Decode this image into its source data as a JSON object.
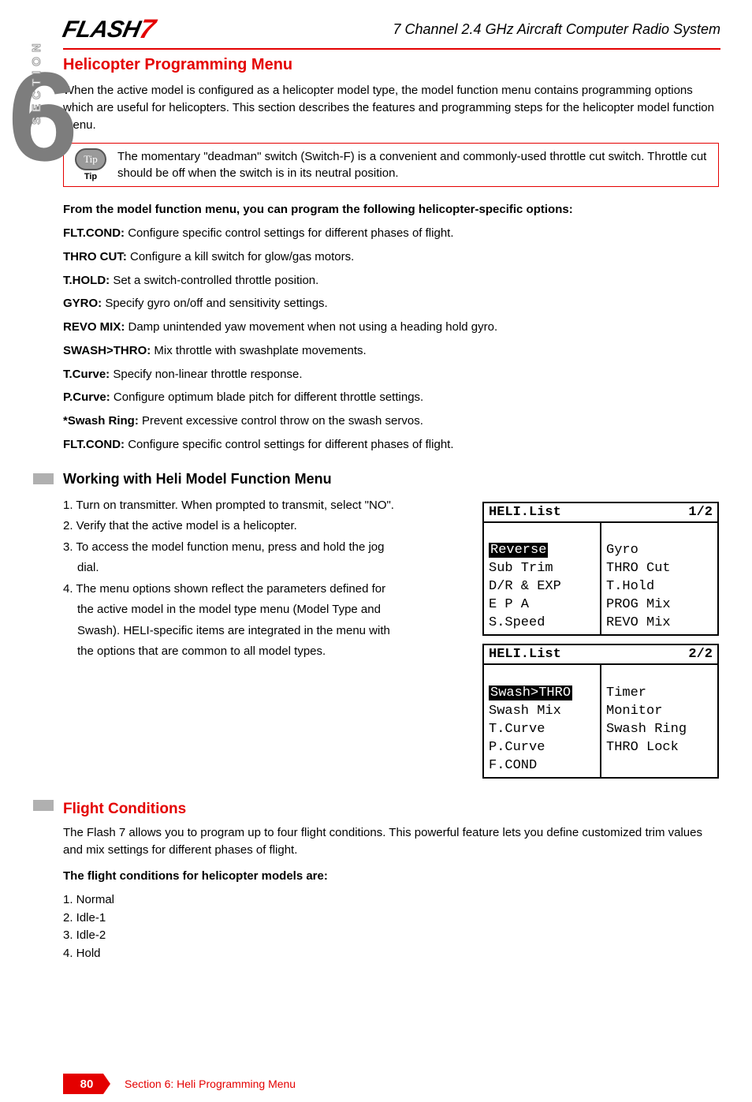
{
  "header": {
    "logo_main": "FLASH",
    "logo_accent": "7",
    "subtitle": "7 Channel 2.4 GHz Aircraft Computer Radio System"
  },
  "side_tab": {
    "number": "6",
    "label": "SECTION"
  },
  "title": "Helicopter Programming Menu",
  "intro": "When the active model is configured as a helicopter model type, the model function menu contains programming options which are useful for helicopters. This section describes the features and programming steps for the helicopter model function menu.",
  "tip": {
    "bubble": "Tip",
    "label": "Tip",
    "text": "The momentary \"deadman\" switch (Switch-F) is a convenient and commonly-used throttle cut switch. Throttle cut should be off when the switch is in its neutral position."
  },
  "lead_bold": "From the model function menu, you can program the following helicopter-specific options:",
  "options": [
    {
      "label": "FLT.COND:",
      "desc": " Configure specific control settings for different phases of flight."
    },
    {
      "label": "THRO CUT:",
      "desc": " Configure a kill switch for glow/gas motors."
    },
    {
      "label": "T.HOLD:",
      "desc": " Set a switch-controlled throttle position."
    },
    {
      "label": "GYRO:",
      "desc": " Specify gyro on/off and sensitivity settings."
    },
    {
      "label": "REVO MIX:",
      "desc": " Damp unintended yaw movement when not using a heading hold gyro."
    },
    {
      "label": "SWASH>THRO:",
      "desc": " Mix throttle with swashplate movements."
    },
    {
      "label": "T.Curve:",
      "desc": " Specify non-linear throttle response."
    },
    {
      "label": "P.Curve:",
      "desc": " Configure optimum blade pitch for different throttle settings."
    },
    {
      "label": "*Swash Ring:",
      "desc": " Prevent excessive control throw on the swash servos."
    },
    {
      "label": "FLT.COND:",
      "desc": " Configure specific control settings for different phases of flight."
    }
  ],
  "working_heading": "Working with Heli Model Function Menu",
  "steps": [
    "1. Turn on transmitter. When prompted to transmit, select \"NO\".",
    "2. Verify that the active model is a helicopter.",
    "3. To access the model function menu, press and hold the jog",
    "    dial.",
    "4. The menu options shown reflect the parameters defined for",
    "    the active model in the model type menu (Model Type and",
    "    Swash). HELI-specific items are integrated in the menu with",
    "    the options that are common to all model types."
  ],
  "lcd1": {
    "title_left": "HELI.List",
    "title_right": "1/2",
    "left": [
      "Reverse",
      "Sub Trim",
      "D/R & EXP",
      "E P A",
      "S.Speed"
    ],
    "right": [
      "Gyro",
      "THRO Cut",
      "T.Hold",
      "PROG Mix",
      "REVO Mix"
    ],
    "hl_index": 0
  },
  "lcd2": {
    "title_left": "HELI.List",
    "title_right": "2/2",
    "left": [
      "Swash>THRO",
      "Swash Mix",
      "T.Curve",
      "P.Curve",
      "F.COND"
    ],
    "right": [
      "Timer",
      "Monitor",
      "Swash Ring",
      "THRO Lock",
      ""
    ],
    "hl_index": 0
  },
  "flight_heading": "Flight Conditions",
  "flight_intro": "The Flash 7 allows you to program up to four flight conditions. This powerful feature lets you define customized trim values and mix settings for different phases of flight.",
  "flight_list_head": "The flight conditions for helicopter models are:",
  "flight_list": [
    "1. Normal",
    "2. Idle-1",
    "3. Idle-2",
    "4. Hold"
  ],
  "footer": {
    "page": "80",
    "label": "Section 6: Heli Programming Menu"
  }
}
